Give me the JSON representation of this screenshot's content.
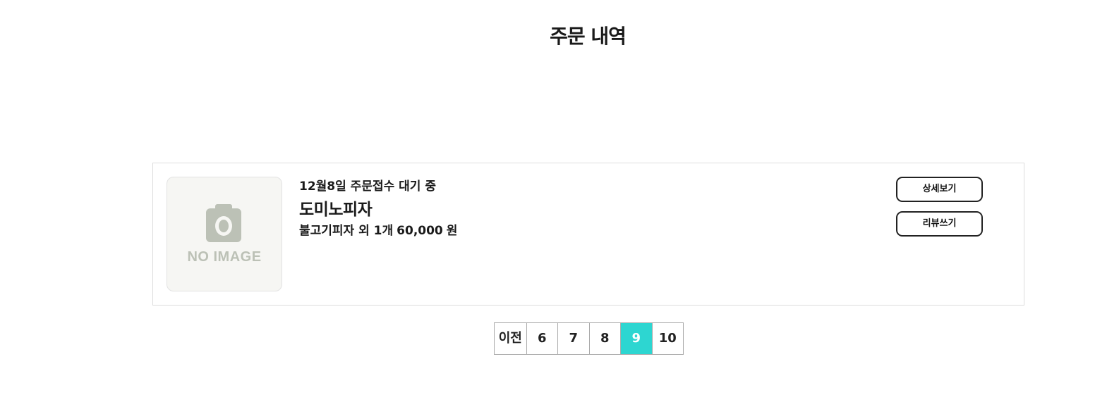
{
  "page": {
    "title": "주문 내역"
  },
  "order": {
    "image_placeholder": "NO IMAGE",
    "status": "12월8일 주문접수 대기 중",
    "store_name": "도미노피자",
    "items_summary": "불고기피자 외 1개",
    "price": "60,000",
    "currency": "원",
    "buttons": {
      "detail_label": "상세보기",
      "review_label": "리뷰쓰기"
    }
  },
  "pagination": {
    "prev_label": "이전",
    "pages": [
      "6",
      "7",
      "8",
      "9",
      "10"
    ],
    "current": "9",
    "active_color": "#2dd6d1"
  },
  "icons": {
    "thumbnail": "camera-icon"
  }
}
